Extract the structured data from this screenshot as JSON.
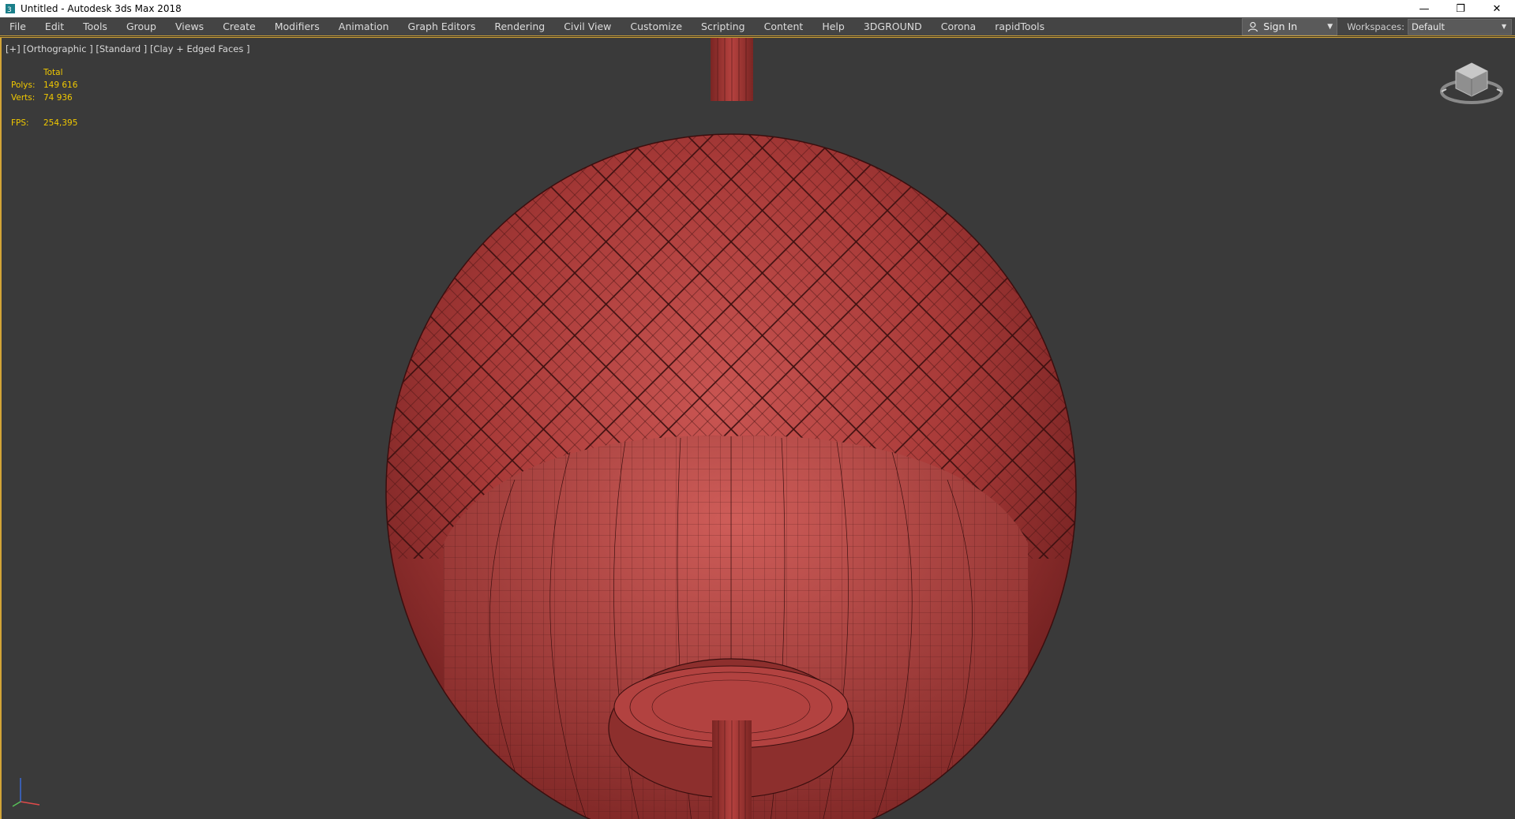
{
  "window": {
    "title": "Untitled - Autodesk 3ds Max 2018",
    "controls": {
      "minimize": "—",
      "restore": "❐",
      "close": "✕"
    }
  },
  "menubar": {
    "items": [
      "File",
      "Edit",
      "Tools",
      "Group",
      "Views",
      "Create",
      "Modifiers",
      "Animation",
      "Graph Editors",
      "Rendering",
      "Civil View",
      "Customize",
      "Scripting",
      "Content",
      "Help",
      "3DGROUND",
      "Corona",
      "rapidTools"
    ],
    "signin_label": "Sign In",
    "workspaces_label": "Workspaces:",
    "workspace_value": "Default"
  },
  "viewport": {
    "label": "[+] [Orthographic ] [Standard ] [Clay + Edged Faces ]",
    "stats": {
      "total_label": "Total",
      "polys_label": "Polys:",
      "polys_value": "149 616",
      "verts_label": "Verts:",
      "verts_value": "74 936",
      "fps_label": "FPS:",
      "fps_value": "254,395"
    }
  },
  "colors": {
    "accent": "#d2a437",
    "stats_text": "#f0c800",
    "viewport_bg": "#3a3a3a",
    "model_color": "#b5403e"
  },
  "icons": [
    "app-icon",
    "user-icon",
    "viewcube-icon",
    "axis-tripod-icon",
    "minimize-icon",
    "restore-icon",
    "close-icon"
  ]
}
